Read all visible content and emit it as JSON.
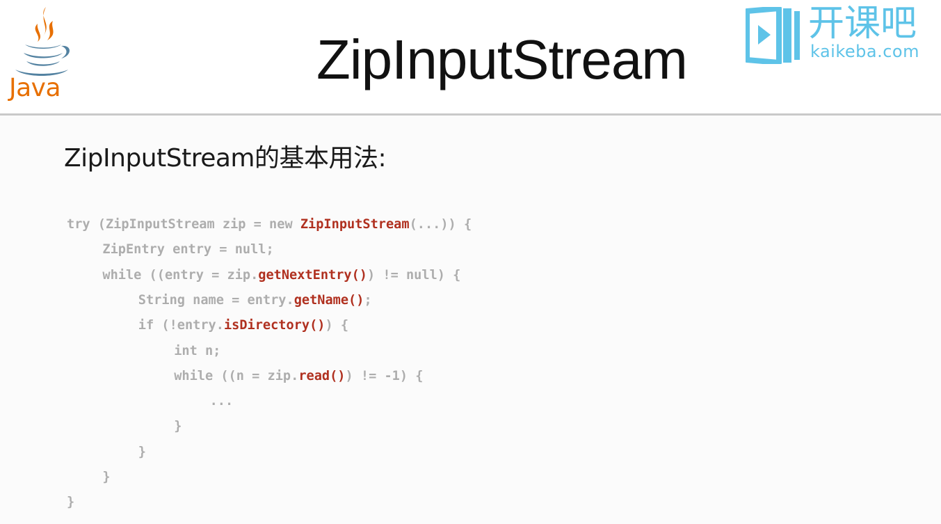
{
  "header": {
    "title": "ZipInputStream",
    "java_logo_text": "Java",
    "brand_cn": "开课吧",
    "brand_en": "kaikeba.com"
  },
  "content": {
    "subtitle": "ZipInputStream的基本用法:",
    "code_lines": [
      {
        "indent": "",
        "segments": [
          {
            "t": "try (ZipInputStream zip = new ",
            "hl": false
          },
          {
            "t": "ZipInputStream",
            "hl": true
          },
          {
            "t": "(...)) {",
            "hl": false
          }
        ]
      },
      {
        "indent": "    ",
        "segments": [
          {
            "t": "ZipEntry entry = null;",
            "hl": false
          }
        ]
      },
      {
        "indent": "    ",
        "segments": [
          {
            "t": "while ((entry = zip.",
            "hl": false
          },
          {
            "t": "getNextEntry()",
            "hl": true
          },
          {
            "t": ") != null) {",
            "hl": false
          }
        ]
      },
      {
        "indent": "        ",
        "segments": [
          {
            "t": "String name = entry.",
            "hl": false
          },
          {
            "t": "getName()",
            "hl": true
          },
          {
            "t": ";",
            "hl": false
          }
        ]
      },
      {
        "indent": "        ",
        "segments": [
          {
            "t": "if (!entry.",
            "hl": false
          },
          {
            "t": "isDirectory()",
            "hl": true
          },
          {
            "t": ") {",
            "hl": false
          }
        ]
      },
      {
        "indent": "            ",
        "segments": [
          {
            "t": "int n;",
            "hl": false
          }
        ]
      },
      {
        "indent": "            ",
        "segments": [
          {
            "t": "while ((n = zip.",
            "hl": false
          },
          {
            "t": "read()",
            "hl": true
          },
          {
            "t": ") != -1) {",
            "hl": false
          }
        ]
      },
      {
        "indent": "                ",
        "segments": [
          {
            "t": "...",
            "hl": false
          }
        ]
      },
      {
        "indent": "            ",
        "segments": [
          {
            "t": "}",
            "hl": false
          }
        ]
      },
      {
        "indent": "        ",
        "segments": [
          {
            "t": "}",
            "hl": false
          }
        ]
      },
      {
        "indent": "    ",
        "segments": [
          {
            "t": "}",
            "hl": false
          }
        ]
      },
      {
        "indent": "",
        "segments": [
          {
            "t": "}",
            "hl": false
          }
        ]
      }
    ]
  },
  "colors": {
    "code_plain": "#adadad",
    "code_highlight": "#b0301f",
    "brand_blue": "#5ec3e8",
    "java_orange": "#e76f00",
    "java_blue": "#5382a1"
  },
  "icons": [
    "java-logo-icon",
    "kaikeba-logo-icon"
  ]
}
